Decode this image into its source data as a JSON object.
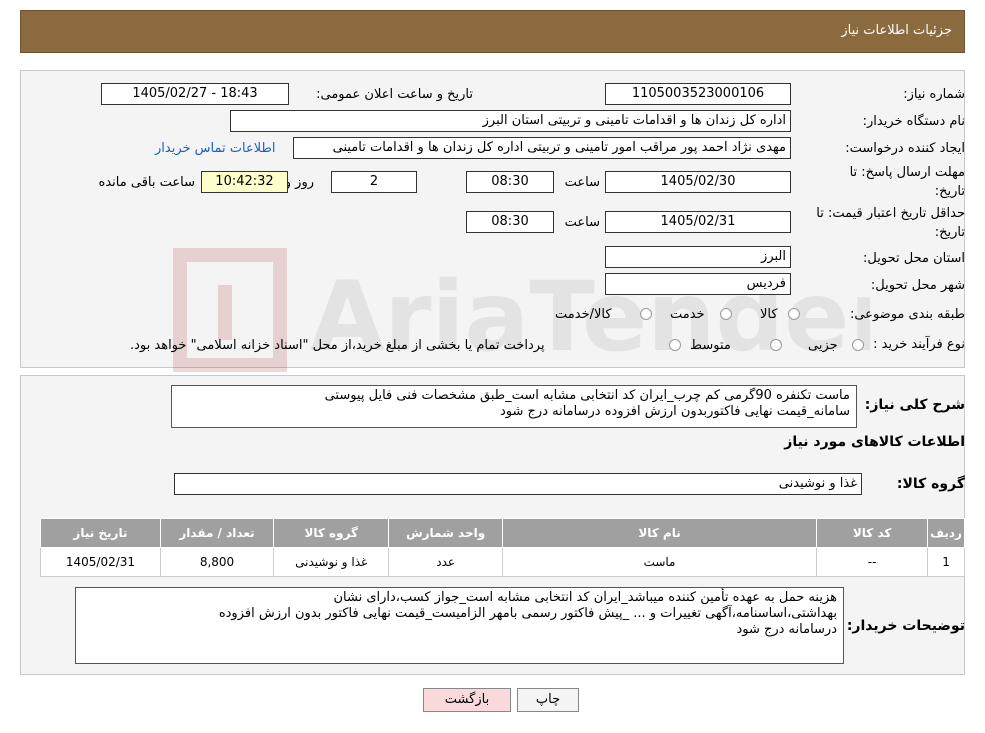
{
  "header": {
    "title": "جزئیات اطلاعات نیاز"
  },
  "fields": {
    "need_number_label": "شماره نیاز:",
    "need_number": "1105003523000106",
    "announce_label": "تاریخ و ساعت اعلان عمومی:",
    "announce_value": "1405/02/27 - 18:43",
    "buyer_org_label": "نام دستگاه خریدار:",
    "buyer_org": "اداره کل زندان ها و اقدامات تامینی و تربیتی استان البرز",
    "creator_label": "ایجاد کننده درخواست:",
    "creator": "مهدی نژاد احمد پور مراقب امور تامینی و تربیتی اداره کل زندان ها و اقدامات تامینی",
    "contact_link": "اطلاعات تماس خریدار",
    "deadline_label_1": "مهلت ارسال پاسخ: تا",
    "deadline_label_2": "تاریخ:",
    "deadline_date": "1405/02/30",
    "time_label": "ساعت",
    "deadline_time": "08:30",
    "days_value": "2",
    "days_label": "روز و",
    "remaining_time": "10:42:32",
    "remaining_label": "ساعت باقی مانده",
    "validity_label_1": "حداقل تاریخ اعتبار قیمت: تا",
    "validity_label_2": "تاریخ:",
    "validity_date": "1405/02/31",
    "validity_time": "08:30",
    "province_label": "استان محل تحویل:",
    "province": "البرز",
    "city_label": "شهر محل تحویل:",
    "city": "فردیس",
    "category_label": "طبقه بندی موضوعی:",
    "category_options": [
      "کالا",
      "خدمت",
      "کالا/خدمت"
    ],
    "process_label": "نوع فرآیند خرید :",
    "process_options": [
      "جزیی",
      "متوسط"
    ],
    "payment_note": "پرداخت تمام یا بخشی از مبلغ خرید،از محل \"اسناد خزانه اسلامی\" خواهد بود."
  },
  "description": {
    "label": "شرح کلی نیاز:",
    "line1": "ماست تکنفره 90گرمی کم چرب_ایران کد انتخابی مشابه است_طبق مشخصات فنی فایل پیوستی",
    "line2": "سامانه_قیمت نهایی فاکتوربدون ارزش افزوده درسامانه درج شود"
  },
  "goods": {
    "section_title": "اطلاعات کالاهای مورد نیاز",
    "group_label": "گروه کالا:",
    "group_value": "غذا و نوشیدنی",
    "columns": [
      "ردیف",
      "کد کالا",
      "نام کالا",
      "واحد شمارش",
      "گروه کالا",
      "تعداد / مقدار",
      "تاریخ نیاز"
    ],
    "rows": [
      [
        "1",
        "--",
        "ماست",
        "عدد",
        "غذا و نوشیدنی",
        "8,800",
        "1405/02/31"
      ]
    ]
  },
  "buyer_notes": {
    "label": "توضیحات خریدار:",
    "line1": "هزینه حمل به عهده تأمین کننده میباشد_ایران کد انتخابی مشابه است_جواز کسب،دارای نشان",
    "line2": "بهداشتی،اساسنامه،آگهی تغییرات و ... _پیش فاکتور رسمی بامهر الزامیست_قیمت نهایی فاکتور بدون ارزش افزوده",
    "line3": "درسامانه درج شود"
  },
  "buttons": {
    "print": "چاپ",
    "back": "بازگشت"
  },
  "watermark": {
    "text": "AriaTender.neT"
  },
  "colors": {
    "header": "#8a6a3e",
    "link": "#1a5fc9",
    "table_header": "#a0a0a0",
    "back_button": "#f9d9d9"
  }
}
